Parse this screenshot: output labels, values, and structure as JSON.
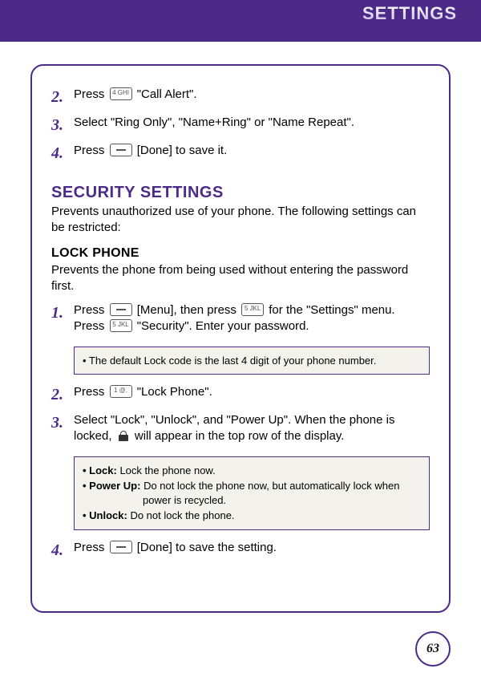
{
  "header": {
    "title": "SETTINGS"
  },
  "topSteps": [
    {
      "n": "2.",
      "pre": "Press ",
      "key": "4 GHI",
      "post": " \"Call Alert\"."
    },
    {
      "n": "3.",
      "text": "Select \"Ring Only\", \"Name+Ring\" or \"Name Repeat\"."
    },
    {
      "n": "4.",
      "pre": "Press ",
      "key_dash": true,
      "post": " [Done] to save it."
    }
  ],
  "secHeading": "SECURITY SETTINGS",
  "secDesc": "Prevents unauthorized use of your phone.  The following settings can be restricted:",
  "subHeading": "LOCK PHONE",
  "subDesc": "Prevents the phone from being used without entering the password first.",
  "lockSteps1": {
    "n": "1.",
    "line1_pre": "Press ",
    "line1_mid": " [Menu], then press ",
    "line1_post": " for the \"Settings\" menu.",
    "line2_pre": "Press ",
    "line2_post": " \"Security\".  Enter your password."
  },
  "note1": "• The default Lock code is the last 4 digit of your phone number.",
  "lockStep2": {
    "n": "2.",
    "pre": "Press ",
    "key": "1 @.",
    "post": " \"Lock Phone\"."
  },
  "lockStep3": {
    "n": "3.",
    "line1": "Select \"Lock\", \"Unlock\", and \"Power Up\".  When the phone is",
    "line2_pre": "locked,  ",
    "line2_post": "  will appear in the top row of the display."
  },
  "note2": {
    "lockLabel": "• Lock: ",
    "lockText": "Lock the phone now.",
    "powerLabel": "• Power Up: ",
    "powerText": "Do not lock the phone now, but automatically lock when power is recycled.",
    "unlockLabel": "• Unlock: ",
    "unlockText": "Do not lock the phone."
  },
  "lockStep4": {
    "n": "4.",
    "pre": "Press ",
    "key_dash": true,
    "post": " [Done] to save the setting."
  },
  "keys": {
    "menu_dash": "—",
    "five": "5 JKL"
  },
  "pageNumber": "63"
}
